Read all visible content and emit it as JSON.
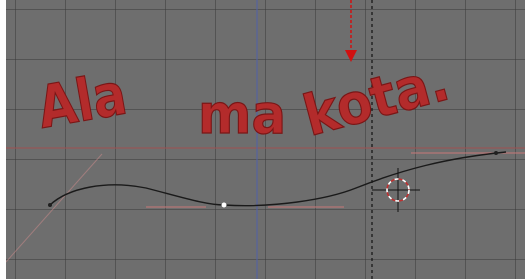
{
  "viewport": {
    "background_color": "#6e6e6e",
    "grid_color": "#3c3c3c",
    "x_axis_color": "#a05050",
    "y_axis_color": "#5060a8"
  },
  "text_object": {
    "words": [
      "Ala",
      "ma",
      "kota."
    ],
    "fill_color": "#b32b2b",
    "outline_color": "#7a1616"
  },
  "curve": {
    "color": "#1a1a1a",
    "handle_color": "#c87878"
  },
  "annotation": {
    "color": "#d01010",
    "icon": "arrow-down-icon"
  },
  "cursor_3d": {
    "icon": "crosshair-icon"
  }
}
